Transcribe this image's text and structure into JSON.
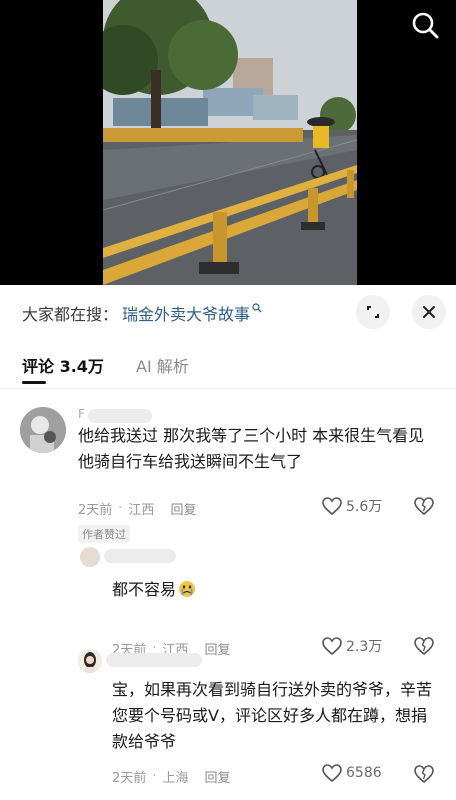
{
  "trending": {
    "prefix": "大家都在搜：",
    "query": "瑞金外卖大爷故事"
  },
  "tabs": {
    "comments_label": "评论 3.4万",
    "ai_label": "AI 解析"
  },
  "comments": [
    {
      "name_hint": "F",
      "text": "他给我送过 那次我等了三个小时 本来很生气看见他骑自行车给我送瞬间不生气了",
      "time": "2天前",
      "location": "江西",
      "reply": "回复",
      "likes": "5.6万",
      "badge": "作者赞过"
    },
    {
      "text": "都不容易",
      "time": "2天前",
      "location": "江西",
      "reply": "回复",
      "likes": "2.3万"
    },
    {
      "text": "宝，如果再次看到骑自行送外卖的爷爷，辛苦您要个号码或V，评论区好多人都在蹲，想捐款给爷爷",
      "time": "2天前",
      "location": "上海",
      "reply": "回复",
      "likes": "6586"
    }
  ],
  "icons": {
    "search": "search-icon",
    "expand": "expand-icon",
    "close": "close-icon",
    "like": "heart-icon",
    "dislike": "broken-heart-icon",
    "emoji": "crying-face-emoji"
  },
  "colors": {
    "link": "#2f5d8c",
    "muted": "#9a9a9a",
    "text": "#1a1a1a"
  }
}
